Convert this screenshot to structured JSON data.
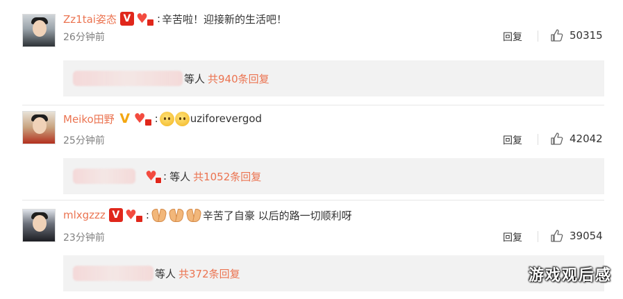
{
  "comments": [
    {
      "username": "Zz1tai姿态",
      "badge": "V",
      "badge_color": "#e0271b",
      "colon": ":",
      "text": "辛苦啦！迎接新的生活吧！",
      "time": "26分钟前",
      "reply_label": "回复",
      "likes": "50315",
      "sub": {
        "others": "等人",
        "total": "共940条回复"
      }
    },
    {
      "username": "Meiko田野",
      "badge": "V",
      "badge_color": "#f3a712",
      "colon": ":",
      "emojis": [
        "crying-face-icon",
        "crying-face-icon"
      ],
      "text": "uziforevergod",
      "time": "25分钟前",
      "reply_label": "回复",
      "likes": "42042",
      "sub": {
        "colon": ":",
        "others": "等人",
        "total": "共1052条回复"
      }
    },
    {
      "username": "mlxgzzz",
      "badge": "V",
      "badge_color": "#e0271b",
      "colon": ":",
      "emojis": [
        "praying-hands-icon",
        "praying-hands-icon",
        "praying-hands-icon"
      ],
      "text": "辛苦了自豪 以后的路一切顺利呀",
      "time": "23分钟前",
      "reply_label": "回复",
      "likes": "39054",
      "sub": {
        "others": "等人",
        "total": "共372条回复"
      }
    }
  ],
  "watermark": "游戏观后感",
  "colors": {
    "accent": "#eb7350",
    "sub_bg": "#f2f2f2",
    "heart": "#f34b3f"
  }
}
